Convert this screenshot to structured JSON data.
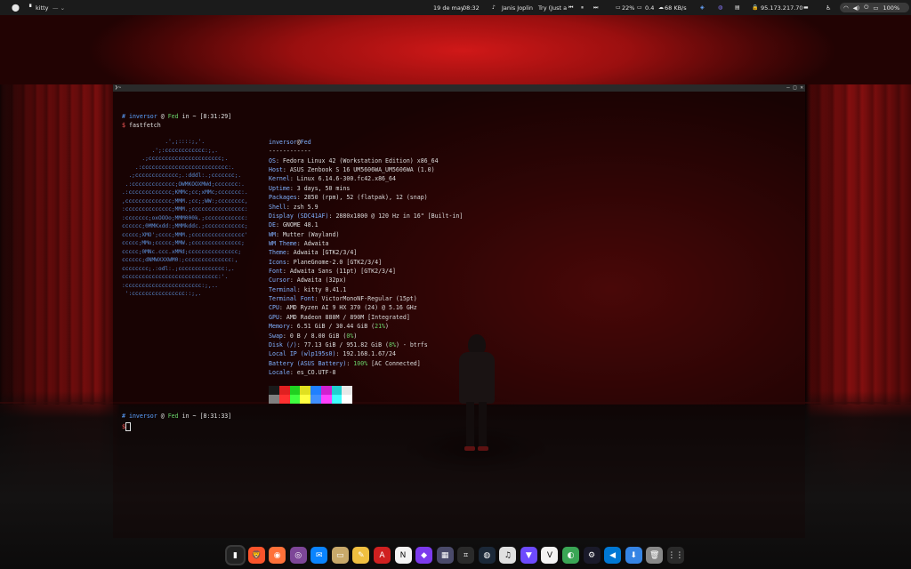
{
  "topbar": {
    "app_name": "kitty",
    "app_menu_glyph": "— ⌄",
    "date": "19 de may",
    "time": "08:32",
    "media_artist": "Janis Joplin",
    "media_title": "Try (Just a",
    "battery_pct_left": "22%",
    "cpu_load": "0.4",
    "net_speed": "68 KB/s",
    "ip_address": "95.173.217.70",
    "battery_pct": "100%"
  },
  "terminal": {
    "title": "❯~",
    "prompt1_hash": "#",
    "prompt1_user": "inversor",
    "prompt1_at": "@",
    "prompt1_host": "Fed",
    "prompt1_in": "in",
    "prompt1_dir": "~",
    "prompt1_time": "[8:31:29]",
    "prompt1_dollar": "$",
    "command1": "fastfetch",
    "user_host_user": "inversor",
    "user_host_at": "@",
    "user_host_host": "Fed",
    "separator": "------------",
    "info": [
      {
        "label": "OS",
        "value": ": Fedora Linux 42 (Workstation Edition) x86_64"
      },
      {
        "label": "Host",
        "value": ": ASUS Zenbook S 16 UM5606WA_UM5606WA (1.0)"
      },
      {
        "label": "Kernel",
        "value": ": Linux 6.14.6-300.fc42.x86_64"
      },
      {
        "label": "Uptime",
        "value": ": 3 days, 50 mins"
      },
      {
        "label": "Packages",
        "value": ": 2850 (rpm), 52 (flatpak), 12 (snap)"
      },
      {
        "label": "Shell",
        "value": ": zsh 5.9"
      },
      {
        "label": "Display (SDC41AF)",
        "value": ": 2880x1800 @ 120 Hz in 16\" [Built-in]"
      },
      {
        "label": "DE",
        "value": ": GNOME 48.1"
      },
      {
        "label": "WM",
        "value": ": Mutter (Wayland)"
      },
      {
        "label": "WM Theme",
        "value": ": Adwaita"
      },
      {
        "label": "Theme",
        "value": ": Adwaita [GTK2/3/4]"
      },
      {
        "label": "Icons",
        "value": ": PlaneGnome-2.0 [GTK2/3/4]"
      },
      {
        "label": "Font",
        "value": ": Adwaita Sans (11pt) [GTK2/3/4]"
      },
      {
        "label": "Cursor",
        "value": ": Adwaita (32px)"
      },
      {
        "label": "Terminal",
        "value": ": kitty 0.41.1"
      },
      {
        "label": "Terminal Font",
        "value": ": VictorMonoNF-Regular (15pt)"
      },
      {
        "label": "CPU",
        "value": ": AMD Ryzen AI 9 HX 370 (24) @ 5.16 GHz"
      },
      {
        "label": "GPU",
        "value": ": AMD Radeon 880M / 890M [Integrated]"
      },
      {
        "label": "Memory",
        "value": ": 6.51 GiB / 30.44 GiB (",
        "pct": "21%",
        "after": ")"
      },
      {
        "label": "Swap",
        "value": ": 0 B / 8.00 GiB (",
        "pct": "0%",
        "after": ")"
      },
      {
        "label": "Disk (/)",
        "value": ": 77.13 GiB / 951.82 GiB (",
        "pct": "8%",
        "after": ") - btrfs"
      },
      {
        "label": "Local IP (wlp195s0)",
        "value": ": 192.168.1.67/24"
      },
      {
        "label": "Battery (ASUS Battery)",
        "value": ": ",
        "pct": "100%",
        "after": " [AC Connected]"
      },
      {
        "label": "Locale",
        "value": ": es_CO.UTF-8"
      }
    ],
    "logo_lines": [
      "             .',;::::;,'.",
      "         .';:cccccccccccc:;,.",
      "      .;cccccccccccccccccccccc;.",
      "    .:cccccccccccccccccccccccccc:.",
      "  .;ccccccccccccc;.:dddl:.;ccccccc;.",
      " .:ccccccccccccc;OWMKOOXMWd;ccccccc:.",
      ".:ccccccccccccc;KMMc;cc;xMMc;ccccccc:.",
      ",cccccccccccccc;MMM.;cc;;WW:;cccccccc,",
      ":cccccccccccccc;MMM.;cccccccccccccccc:",
      ":ccccccc;oxOOOo;MMM000k.;cccccccccccc:",
      "cccccc;0MMKxdd:;MMMkddc.;cccccccccccc;",
      "ccccc;XMO';cccc;MMM.;cccccccccccccccc'",
      "ccccc;MMo;ccccc;MMW.;ccccccccccccccc;",
      "ccccc;0MNc.ccc.xMMd;ccccccccccccccc;",
      "cccccc;dNMWXXXWM0:;cccccccccccccc:,",
      "cccccccc;.:odl:.;cccccccccccccc:,.",
      "ccccccccccccccccccccccccccccc:'.",
      ":ccccccccccccccccccccccc:;,..",
      " ':cccccccccccccccc::;,."
    ],
    "palette_top": [
      "#1a1a1a",
      "#e02020",
      "#20d020",
      "#e0e020",
      "#2080ff",
      "#d020d0",
      "#20d0d0",
      "#e8e8e8"
    ],
    "palette_bottom": [
      "#808080",
      "#ff3030",
      "#40ff40",
      "#ffff40",
      "#4090ff",
      "#ff40ff",
      "#40ffff",
      "#ffffff"
    ],
    "prompt2_hash": "#",
    "prompt2_user": "inversor",
    "prompt2_at": "@",
    "prompt2_host": "Fed",
    "prompt2_in": "in",
    "prompt2_dir": "~",
    "prompt2_time": "[8:31:33]",
    "prompt2_dollar": "$"
  },
  "dock": {
    "apps": [
      {
        "name": "terminal",
        "glyph": "▮",
        "bg": "#222222"
      },
      {
        "name": "brave",
        "glyph": "🦁",
        "bg": "#fb542b"
      },
      {
        "name": "firefox",
        "glyph": "◉",
        "bg": "#ff7139"
      },
      {
        "name": "tor-browser",
        "glyph": "◎",
        "bg": "#7d4698"
      },
      {
        "name": "thunderbird",
        "glyph": "✉",
        "bg": "#0a84ff"
      },
      {
        "name": "files",
        "glyph": "▭",
        "bg": "#c8a96a"
      },
      {
        "name": "text-editor",
        "glyph": "✎",
        "bg": "#f0c040"
      },
      {
        "name": "pdf-viewer",
        "glyph": "A",
        "bg": "#d02020"
      },
      {
        "name": "notion",
        "glyph": "N",
        "bg": "#f4f4f4"
      },
      {
        "name": "obsidian",
        "glyph": "◆",
        "bg": "#7c3aed"
      },
      {
        "name": "calculator",
        "glyph": "▦",
        "bg": "#4a4a6a"
      },
      {
        "name": "screenshot",
        "glyph": "⌗",
        "bg": "#2a2a2a"
      },
      {
        "name": "steam",
        "glyph": "◍",
        "bg": "#1b2838"
      },
      {
        "name": "music",
        "glyph": "♫",
        "bg": "#e0e0e0"
      },
      {
        "name": "proton-vpn",
        "glyph": "▼",
        "bg": "#6d4aff"
      },
      {
        "name": "vim",
        "glyph": "V",
        "bg": "#f4f4f4"
      },
      {
        "name": "maps",
        "glyph": "◐",
        "bg": "#3aa655"
      },
      {
        "name": "settings",
        "glyph": "⚙",
        "bg": "#1a1a2a"
      },
      {
        "name": "vscode",
        "glyph": "◀",
        "bg": "#0078d4"
      },
      {
        "name": "software",
        "glyph": "⬇",
        "bg": "#3584e4"
      },
      {
        "name": "trash",
        "glyph": "🗑",
        "bg": "#888888"
      },
      {
        "name": "app-grid",
        "glyph": "⋮⋮",
        "bg": "#2a2a2a"
      }
    ]
  }
}
